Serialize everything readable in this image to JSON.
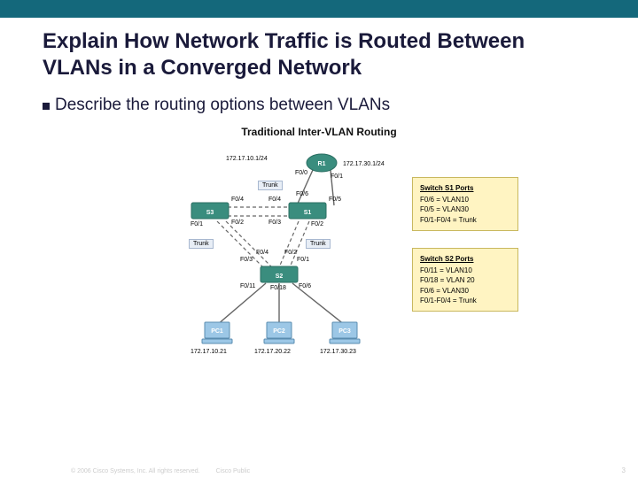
{
  "header": {
    "title_line1": "Explain How Network Traffic is Routed Between VLANs in a Converged Network"
  },
  "bullet": {
    "text": "Describe the routing options between VLANs"
  },
  "diagram": {
    "title": "Traditional Inter-VLAN Routing",
    "router": {
      "name": "R1",
      "left_net": "172.17.10.1/24",
      "right_net": "172.17.30.1/24",
      "left_if": "F0/0",
      "right_if": "F0/1"
    },
    "s1": {
      "name": "S1",
      "tl": "F0/4",
      "tr": "F0/5",
      "bl": "F0/3",
      "br": "F0/2",
      "up": "F0/6"
    },
    "s3": {
      "name": "S3",
      "tr": "F0/4",
      "br": "F0/2",
      "bl": "F0/1"
    },
    "s2": {
      "name": "S2",
      "tl": "F0/3",
      "tr": "F0/1",
      "up_l": "F0/4",
      "up_r": "F0/2",
      "b1": "F0/11",
      "b2": "F0/18",
      "b3": "F0/6"
    },
    "trunk": "Trunk",
    "pcs": {
      "pc1": {
        "name": "PC1",
        "ip": "172.17.10.21"
      },
      "pc2": {
        "name": "PC2",
        "ip": "172.17.20.22"
      },
      "pc3": {
        "name": "PC3",
        "ip": "172.17.30.23"
      }
    },
    "portbox_s1": {
      "header": "Switch S1 Ports",
      "lines": [
        "F0/6 = VLAN10",
        "F0/5 = VLAN30",
        "F0/1-F0/4 = Trunk"
      ]
    },
    "portbox_s2": {
      "header": "Switch S2 Ports",
      "lines": [
        "F0/11 = VLAN10",
        "F0/18 = VLAN 20",
        "F0/6 = VLAN30",
        "F0/1-F0/4 = Trunk"
      ]
    }
  },
  "footer": {
    "copyright": "© 2006 Cisco Systems, Inc. All rights reserved.",
    "classification": "Cisco Public",
    "page": "3"
  }
}
